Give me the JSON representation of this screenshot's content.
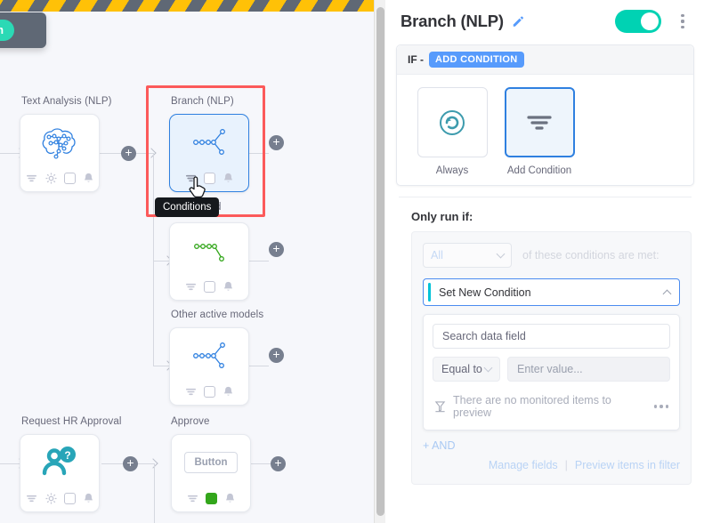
{
  "canvas": {
    "publish_button": "Publish",
    "tooltip": "Conditions",
    "background_text": "was found",
    "nodes": [
      {
        "label": "Text Analysis (NLP)",
        "icon": "brain-icon"
      },
      {
        "label": "Branch (NLP)",
        "icon": "branch-icon"
      },
      {
        "label": "",
        "icon": "branch-green-icon"
      },
      {
        "label": "Other active models",
        "icon": "branch-icon"
      },
      {
        "label": "Request HR Approval",
        "icon": "person-question-icon"
      },
      {
        "label": "Approve",
        "icon": "button-widget",
        "widget_label": "Button"
      }
    ],
    "add_button_label": "+"
  },
  "panel": {
    "title": "Branch (NLP)",
    "edit_icon": "pencil-icon",
    "toggle_on": true,
    "menu_icon": "kebab-menu-icon",
    "if_label": "IF -",
    "add_condition_badge": "ADD CONDITION",
    "tiles": [
      {
        "label": "Always",
        "icon": "refresh-circle-icon",
        "active": false
      },
      {
        "label": "Add Condition",
        "icon": "filter-icon",
        "active": true
      }
    ],
    "only_run_if": "Only run if:",
    "match_select": "All",
    "match_suffix": "of these conditions are met:",
    "set_new_condition": "Set New Condition",
    "search_placeholder": "Search data field",
    "operator_select": "Equal to",
    "value_placeholder": "Enter value...",
    "preview_message": "There are no monitored items to preview",
    "more_icon": "ellipsis-icon",
    "and_link": "+ AND",
    "manage_fields": "Manage fields",
    "separator": "|",
    "preview_items": "Preview items in filter"
  },
  "colors": {
    "accent_blue": "#579bfc",
    "toggle_green": "#00d2b3",
    "highlight_red": "#fc5a5a",
    "hazard_yellow": "#ffc107",
    "hazard_gray": "#5f6875",
    "node_blue": "#2f80e0",
    "node_green": "#33a61b"
  }
}
